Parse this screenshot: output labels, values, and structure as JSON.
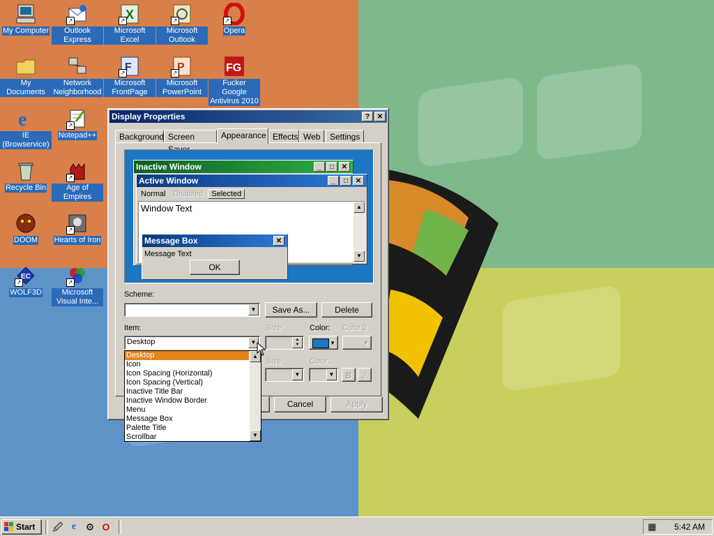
{
  "desktop_icons": [
    {
      "id": "my-computer",
      "label": "My Computer",
      "icon": "computer-icon"
    },
    {
      "id": "outlook-express",
      "label": "Outlook Express",
      "icon": "outlook-express-icon"
    },
    {
      "id": "excel",
      "label": "Microsoft Excel",
      "icon": "excel-icon"
    },
    {
      "id": "outlook",
      "label": "Microsoft Outlook",
      "icon": "outlook-icon"
    },
    {
      "id": "opera",
      "label": "Opera",
      "icon": "opera-icon"
    },
    {
      "id": "my-documents",
      "label": "My Documents",
      "icon": "folder-icon"
    },
    {
      "id": "network",
      "label": "Network Neighborhood",
      "icon": "network-icon"
    },
    {
      "id": "frontpage",
      "label": "Microsoft FrontPage",
      "icon": "frontpage-icon"
    },
    {
      "id": "powerpoint",
      "label": "Microsoft PowerPoint",
      "icon": "powerpoint-icon"
    },
    {
      "id": "antivirus",
      "label": "Fucker Google Antivirus 2010",
      "icon": "antivirus-icon"
    },
    {
      "id": "ie",
      "label": "IE (Browservice)",
      "icon": "ie-icon"
    },
    {
      "id": "notepad",
      "label": "Notepad++",
      "icon": "notepad-icon"
    },
    {
      "id": "recycle",
      "label": "Recycle Bin",
      "icon": "recycle-bin-icon"
    },
    {
      "id": "aoe",
      "label": "Age of Empires",
      "icon": "age-of-empires-icon"
    },
    {
      "id": "doom",
      "label": "DOOM",
      "icon": "doom-icon"
    },
    {
      "id": "hoi",
      "label": "Hearts of Iron",
      "icon": "hearts-of-iron-icon"
    },
    {
      "id": "wolf3d",
      "label": "WOLF3D",
      "icon": "wolf3d-icon"
    },
    {
      "id": "visual",
      "label": "Microsoft Visual Inte...",
      "icon": "visual-interdev-icon"
    }
  ],
  "dialog": {
    "title": "Display Properties",
    "help": "?",
    "close": "✕",
    "tabs": [
      "Background",
      "Screen Saver",
      "Appearance",
      "Effects",
      "Web",
      "Settings"
    ],
    "active_tab": "Appearance",
    "preview": {
      "inactive_title": "Inactive Window",
      "active_title": "Active Window",
      "menu_normal": "Normal",
      "menu_disabled": "Disabled",
      "menu_selected": "Selected",
      "window_text": "Window Text",
      "msgbox_title": "Message Box",
      "msgbox_text": "Message Text",
      "ok": "OK"
    },
    "scheme_label": "Scheme:",
    "scheme_value": "",
    "save_as": "Save As...",
    "delete": "Delete",
    "item_label": "Item:",
    "item_value": "Desktop",
    "size_label": "Size:",
    "color_label": "Color:",
    "color2_label": "Color 2",
    "font_size_label": "Size:",
    "font_color_label": "Color:",
    "bold": "B",
    "italic": "/",
    "cancel": "Cancel",
    "apply": "Apply",
    "desktop_color": "#1d76c2",
    "item_options": [
      "Desktop",
      "Icon",
      "Icon Spacing (Horizontal)",
      "Icon Spacing (Vertical)",
      "Inactive Title Bar",
      "Inactive Window Border",
      "Menu",
      "Message Box",
      "Palette Title",
      "Scrollbar"
    ]
  },
  "taskbar": {
    "start": "Start",
    "clock": "5:42 AM",
    "quick_launch": [
      "show-desktop-icon",
      "ie-icon",
      "channels-icon",
      "opera-icon"
    ]
  }
}
